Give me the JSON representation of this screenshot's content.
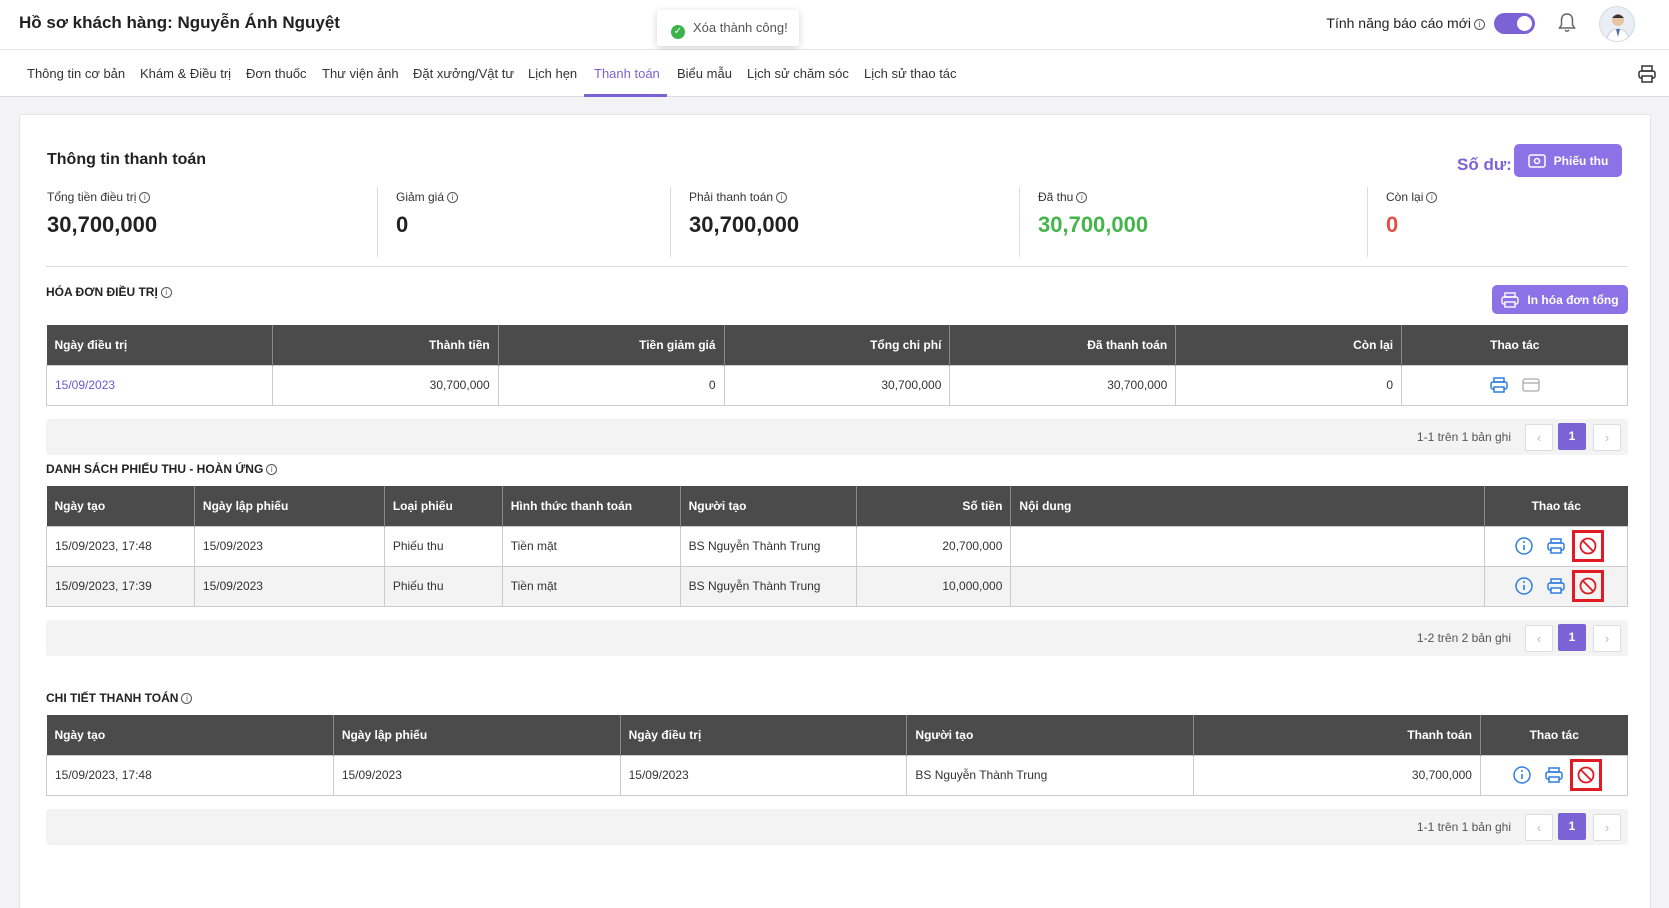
{
  "header": {
    "title": "Hồ sơ khách hàng: Nguyễn Ánh Nguyệt",
    "feature_label": "Tính năng báo cáo mới"
  },
  "toast": {
    "message": "Xóa thành công!"
  },
  "tabs": [
    {
      "label": "Thông tin cơ bản"
    },
    {
      "label": "Khám & Điều trị"
    },
    {
      "label": "Đơn thuốc"
    },
    {
      "label": "Thư viện ảnh"
    },
    {
      "label": "Đặt xưởng/Vật tư"
    },
    {
      "label": "Lịch hẹn"
    },
    {
      "label": "Thanh toán"
    },
    {
      "label": "Biểu mẫu"
    },
    {
      "label": "Lịch sử chăm sóc"
    },
    {
      "label": "Lịch sử thao tác"
    }
  ],
  "payment": {
    "title": "Thông tin thanh toán",
    "balance": "Số dư: 0",
    "receipt_button": "Phiếu thu",
    "stats": [
      {
        "label": "Tổng tiền điều trị",
        "value": "30,700,000"
      },
      {
        "label": "Giảm giá",
        "value": "0"
      },
      {
        "label": "Phải thanh toán",
        "value": "30,700,000"
      },
      {
        "label": "Đã thu",
        "value": "30,700,000"
      },
      {
        "label": "Còn lại",
        "value": "0"
      }
    ]
  },
  "invoices": {
    "title": "HÓA ĐƠN ĐIỀU TRỊ",
    "print_button": "In hóa đơn tổng",
    "headers": [
      "Ngày điều trị",
      "Thành tiền",
      "Tiền giảm giá",
      "Tổng chi phí",
      "Đã thanh toán",
      "Còn lại",
      "Thao tác"
    ],
    "rows": [
      [
        "15/09/2023",
        "30,700,000",
        "0",
        "30,700,000",
        "30,700,000",
        "0"
      ]
    ],
    "pager": "1-1 trên 1 bản ghi",
    "page": "1"
  },
  "receipts": {
    "title": "DANH SÁCH PHIẾU THU - HOÀN ỨNG",
    "headers": [
      "Ngày tạo",
      "Ngày lập phiếu",
      "Loại phiếu",
      "Hình thức thanh toán",
      "Người tạo",
      "Số tiền",
      "Nội dung",
      "Thao tác"
    ],
    "rows": [
      [
        "15/09/2023, 17:48",
        "15/09/2023",
        "Phiếu thu",
        "Tiền mặt",
        "BS Nguyễn Thành Trung",
        "20,700,000",
        ""
      ],
      [
        "15/09/2023, 17:39",
        "15/09/2023",
        "Phiếu thu",
        "Tiền mặt",
        "BS Nguyễn Thành Trung",
        "10,000,000",
        ""
      ]
    ],
    "pager": "1-2 trên 2 bản ghi",
    "page": "1"
  },
  "details": {
    "title": "CHI TIẾT THANH TOÁN",
    "headers": [
      "Ngày tạo",
      "Ngày lập phiếu",
      "Ngày điều trị",
      "Người tạo",
      "Thanh toán",
      "Thao tác"
    ],
    "rows": [
      [
        "15/09/2023, 17:48",
        "15/09/2023",
        "15/09/2023",
        "BS Nguyễn Thành Trung",
        "30,700,000"
      ]
    ],
    "pager": "1-1 trên 1 bản ghi",
    "page": "1"
  },
  "colors": {
    "accent": "#7b63d6",
    "header_dark": "#4b4b4b",
    "green": "#44b54a",
    "red": "#e2504a",
    "highlight": "#e01b24"
  },
  "icons": {
    "info": "info-icon",
    "print": "print-icon",
    "card": "card-icon",
    "cancel": "cancel-icon",
    "bell": "bell-icon"
  }
}
